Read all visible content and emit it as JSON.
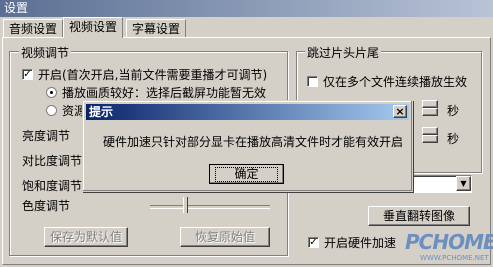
{
  "window": {
    "title": "设置"
  },
  "tabs": [
    {
      "label": "音频设置",
      "active": false
    },
    {
      "label": "视频设置",
      "active": true
    },
    {
      "label": "字幕设置",
      "active": false
    }
  ],
  "video_adjust": {
    "group_label": "视频调节",
    "enable": {
      "label": "开启(首次开启,当前文件需要重播才可调节)",
      "checked": true
    },
    "options": [
      {
        "label": "播放画质较好：选择后截屏功能暂无效",
        "selected": true
      },
      {
        "label": "资源",
        "selected": false
      }
    ],
    "sliders": [
      {
        "label": "亮度调节"
      },
      {
        "label": "对比度调节"
      },
      {
        "label": "饱和度调节"
      },
      {
        "label": "色度调节"
      }
    ],
    "save_default_label": "保存为默认值",
    "restore_label": "恢复原始值"
  },
  "skip": {
    "group_label": "跳过片头片尾",
    "only_continuous": {
      "label": "仅在多个文件连续播放生效",
      "checked": false
    },
    "seconds_unit": "秒"
  },
  "flip_button_label": "垂直翻转图像",
  "hw_accel": {
    "label": "开启硬件加速",
    "checked": true
  },
  "dialog": {
    "title": "提示",
    "close_glyph": "×",
    "message": "硬件加速只针对部分显卡在播放高清文件时才能有效开启",
    "ok_label": "确定"
  },
  "watermark": {
    "brand": "PCHOME",
    "url": "WWW.PCHOME.NET"
  }
}
